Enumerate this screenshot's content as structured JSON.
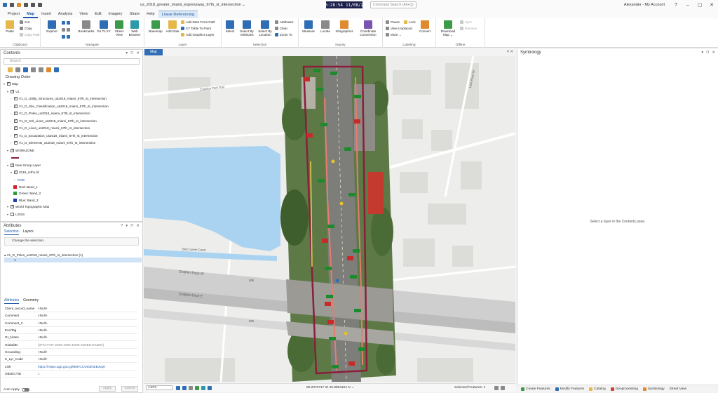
{
  "window": {
    "title": "us_2018_greater_miami_expressway_67th_st_intersection ⌄",
    "clock_time": "16:28:54",
    "clock_date": "11/08/26",
    "command_search_placeholder": "Command Search (Alt+Q)",
    "user": "Alexander - My Account",
    "help": "?",
    "minimize": "–",
    "restore": "▢",
    "close": "✕"
  },
  "menu": {
    "tabs": [
      "Project",
      "Map",
      "Insert",
      "Analysis",
      "View",
      "Edit",
      "Imagery",
      "Share",
      "Help"
    ],
    "active": "Map",
    "context_tab": "Linear Referencing"
  },
  "ribbon": {
    "clipboard": {
      "label": "Clipboard",
      "paste": "Paste",
      "cut": "Cut",
      "copy": "Copy",
      "copy_path": "Copy Path"
    },
    "navigate": {
      "label": "Navigate",
      "explore": "Explore",
      "bookmarks": "Bookmarks",
      "go_to_xy": "Go To XY",
      "street_view": "Street View",
      "web_browser": "Web Browser"
    },
    "layer": {
      "label": "Layer",
      "basemap": "Basemap",
      "add_data": "Add Data",
      "add_data_from_path": "Add Data From Path",
      "xy_table_to_point": "XY Table To Point",
      "add_graphics_layer": "Add Graphics Layer"
    },
    "selection": {
      "label": "Selection",
      "select": "Select",
      "select_by_attributes": "Select By Attributes",
      "select_by_location": "Select By Location",
      "attributes": "Attributes",
      "clear": "Clear",
      "zoom_to": "Zoom To"
    },
    "inquiry": {
      "label": "Inquiry",
      "measure": "Measure",
      "locate": "Locate",
      "infographics": "Infographics",
      "coordinate_conversion": "Coordinate Conversion"
    },
    "labeling": {
      "label": "Labeling",
      "pause": "Pause",
      "lock": "Lock",
      "view_unplaced": "View Unplaced",
      "more": "More ⌄",
      "convert": "Convert"
    },
    "offline": {
      "label": "Offline",
      "download_map": "Download Map ⌄",
      "sync": "Sync",
      "remove": "Remove"
    }
  },
  "contents": {
    "title": "Contents",
    "search_placeholder": "Search",
    "drawing_order": "Drawing Order",
    "layers": [
      {
        "name": "Map",
        "level": 0,
        "checked": true
      },
      {
        "name": "V1",
        "level": 1,
        "checked": true
      },
      {
        "name": "V1_D_Utility_Structures_us2018_miami_67th_st_intersection",
        "level": 2,
        "checked": true
      },
      {
        "name": "V1_D_Site_Classification_us2018_miami_67th_st_intersection",
        "level": 2,
        "checked": true
      },
      {
        "name": "V1_D_Poles_us2018_miami_67th_st_intersection",
        "level": 2,
        "checked": true
      },
      {
        "name": "V1_D_Ctrl_Lines_us2018_miami_67th_st_intersection",
        "level": 2,
        "checked": true
      },
      {
        "name": "V1_D_Lines_us2018_miami_67th_st_intersection",
        "level": 2,
        "checked": true
      },
      {
        "name": "V1_D_Excavation_us2018_miami_67th_st_intersection",
        "level": 2,
        "checked": true
      },
      {
        "name": "V1_D_Elements_us2018_miami_67th_st_intersection",
        "level": 2,
        "checked": true
      },
      {
        "name": "WORKZONE",
        "level": 1,
        "checked": true
      },
      {
        "name": "New Group Layer",
        "level": 1,
        "checked": true
      },
      {
        "name": "2019_ortho.tif",
        "level": 2,
        "checked": true
      },
      {
        "name": "RGB",
        "level": 3,
        "checked": false
      },
      {
        "name": "World Topographic Map",
        "level": 1,
        "checked": true
      },
      {
        "name": "L2019",
        "level": 1,
        "checked": false
      }
    ],
    "rgb_bands": [
      {
        "label": "Red:  Band_1",
        "color": "#d0202a"
      },
      {
        "label": "Green: Band_2",
        "color": "#2e9b3a"
      },
      {
        "label": "Blue:  Band_3",
        "color": "#1f3fae"
      }
    ],
    "workzone_color": "#8b1e3a"
  },
  "attributes": {
    "title": "Attributes",
    "tabs": [
      "Selection",
      "Layers"
    ],
    "change_selection": "Change the selection.",
    "selected_layer": "V1_D_Poles_us2018_miami_67th_st_intersection (1)",
    "selected_feature": "1",
    "subtabs": [
      "Attributes",
      "Geometry"
    ],
    "fields": [
      {
        "name": "Client_record_name",
        "value": "<Null>"
      },
      {
        "name": "Comment",
        "value": "<Null>"
      },
      {
        "name": "Comment_2",
        "value": "<Null>"
      },
      {
        "name": "ExciTag",
        "value": "<Null>"
      },
      {
        "name": "GI_Notes",
        "value": "<Null>"
      },
      {
        "name": "GlobalID",
        "value": "{2F64774F-2068-4592-B408-3D0ED1F1B83}"
      },
      {
        "name": "Grounding",
        "value": "<Null>"
      },
      {
        "name": "K_Lyr_Code",
        "value": "<Null>"
      },
      {
        "name": "Link",
        "value": "https://maps.app.goo.gl/NbHCCvnbdNZBJvq9"
      },
      {
        "name": "OBJECTID",
        "value": "1"
      }
    ],
    "auto_apply": "Auto Apply",
    "apply": "Apply",
    "cancel": "Cancel"
  },
  "map": {
    "tab": "Map",
    "labels": {
      "crandon": "Crandon Park Trail",
      "road_label_1": "Lake Road Dr",
      "water_label": "Bird Corner Canal",
      "expressway_1": "Dolphin Expy W",
      "expressway_2": "Dolphin Expy E",
      "sr_1": "836",
      "sr_2": "836"
    },
    "status": {
      "scale": "1:876",
      "coordinates": "80.2070717 W 25.8994104 N ⌄",
      "selected_features": "Selected Features: 1"
    }
  },
  "symbology": {
    "title": "Symbology",
    "message": "Select a layer in the Contents pane."
  },
  "bottom_tabs": [
    "Create Features",
    "Modify Features",
    "Catalog",
    "Geoprocessing",
    "Symbology",
    "Street View"
  ]
}
